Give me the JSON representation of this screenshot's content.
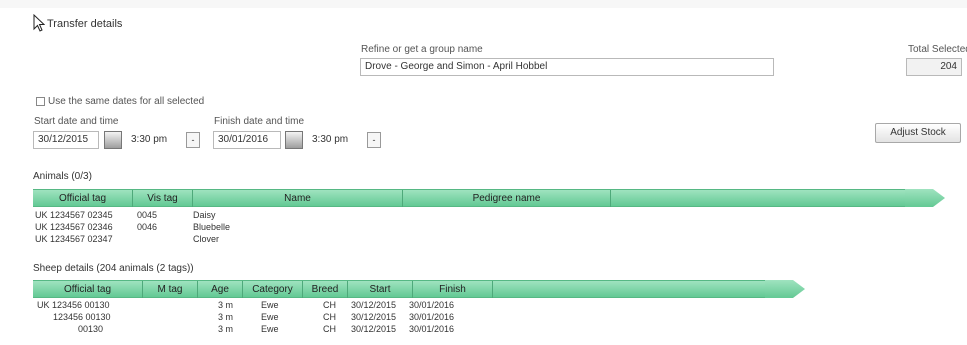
{
  "cursor_icon": "arrow-cursor-icon",
  "page_title": "Transfer details",
  "transfer_group": {
    "label": "Refine or get a group name",
    "value": "Drove - George and Simon - April Hobbel"
  },
  "total_selected": {
    "label": "Total Selected",
    "value": "204"
  },
  "checkbox_label": "Use the same dates for all selected",
  "start_date": {
    "label": "Start date and time",
    "date": "30/12/2015",
    "time": "3:30 pm"
  },
  "finish_date": {
    "label": "Finish date and time",
    "date": "30/01/2016",
    "time": "3:30 pm"
  },
  "stepper_label": "-",
  "adjust_button": "Adjust Stock",
  "animals_section": {
    "title": "Animals (0/3)",
    "columns": [
      "Official tag",
      "Vis tag",
      "Name",
      "Pedigree name"
    ],
    "rows": [
      {
        "official_tag": "UK 1234567 02345",
        "vis_tag": "0045",
        "name": "Daisy",
        "pedigree": ""
      },
      {
        "official_tag": "UK 1234567 02346",
        "vis_tag": "0046",
        "name": "Bluebelle",
        "pedigree": ""
      },
      {
        "official_tag": "UK 1234567 02347",
        "vis_tag": "",
        "name": "Clover",
        "pedigree": ""
      }
    ]
  },
  "sheep_section": {
    "title": "Sheep details (204 animals (2 tags))",
    "columns": [
      "Official tag",
      "M tag",
      "Age",
      "Category",
      "Breed",
      "Start",
      "Finish"
    ],
    "rows": [
      {
        "official_tag": "UK 123456 00130",
        "m_tag": "",
        "age": "3 m",
        "category": "Ewe",
        "breed": "CH",
        "start": "30/12/2015",
        "finish": "30/01/2016"
      },
      {
        "official_tag": "123456 00130",
        "m_tag": "",
        "age": "3 m",
        "category": "Ewe",
        "breed": "CH",
        "start": "30/12/2015",
        "finish": "30/01/2016"
      },
      {
        "official_tag": "00130",
        "m_tag": "",
        "age": "3 m",
        "category": "Ewe",
        "breed": "CH",
        "start": "30/12/2015",
        "finish": "30/01/2016"
      }
    ]
  },
  "colors": {
    "grid_header": "#63c994",
    "grid_header_light": "#9fe3bf"
  }
}
